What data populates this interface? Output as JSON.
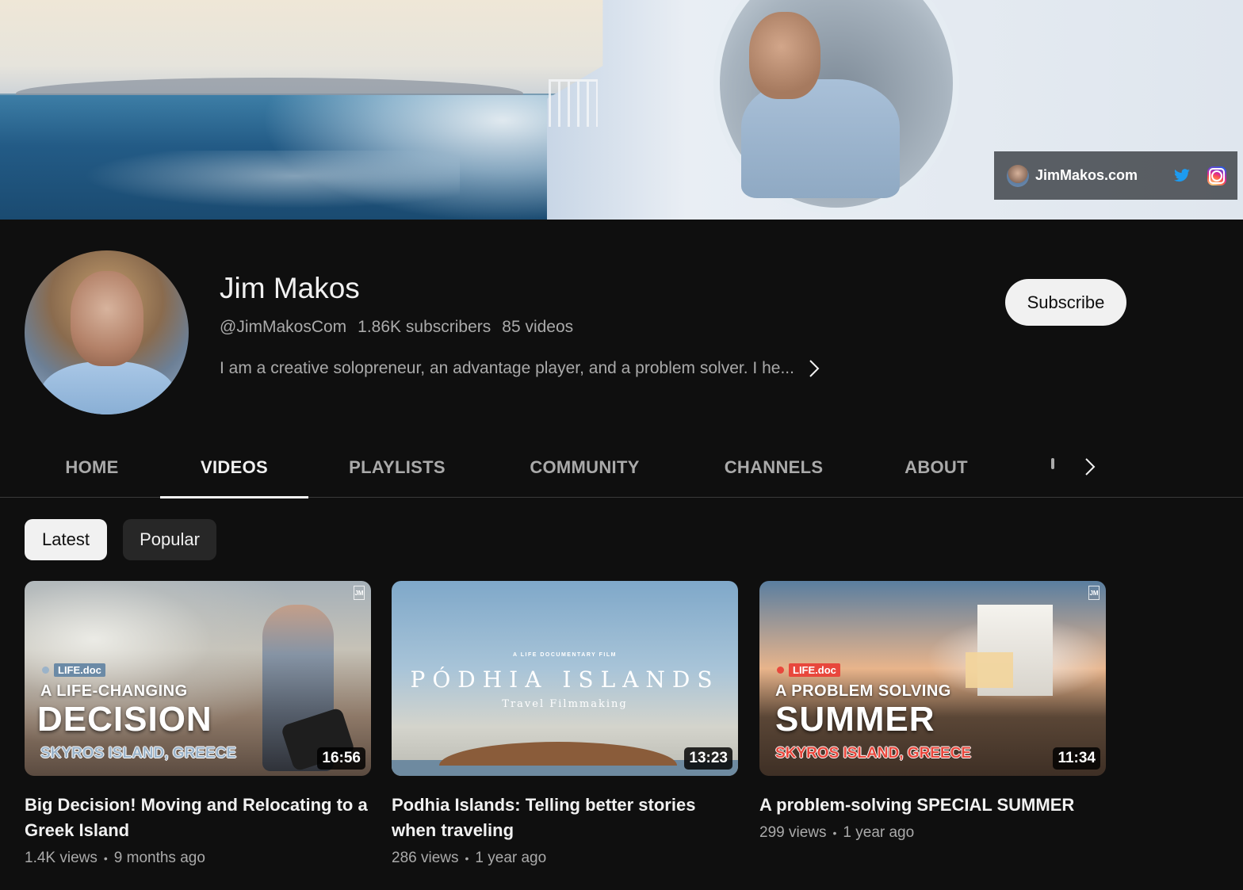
{
  "banner": {
    "link_text": "JimMakos.com",
    "icons": [
      "twitter-icon",
      "instagram-icon"
    ]
  },
  "channel": {
    "name": "Jim Makos",
    "handle": "@JimMakosCom",
    "subscribers": "1.86K subscribers",
    "videos": "85 videos",
    "description": "I am a creative solopreneur, an advantage player, and a problem solver. I he...",
    "subscribe_label": "Subscribe"
  },
  "tabs": [
    {
      "label": "HOME",
      "active": false
    },
    {
      "label": "VIDEOS",
      "active": true
    },
    {
      "label": "PLAYLISTS",
      "active": false
    },
    {
      "label": "COMMUNITY",
      "active": false
    },
    {
      "label": "CHANNELS",
      "active": false
    },
    {
      "label": "ABOUT",
      "active": false
    }
  ],
  "chips": [
    {
      "label": "Latest",
      "selected": true
    },
    {
      "label": "Popular",
      "selected": false
    }
  ],
  "videos": [
    {
      "title": "Big Decision! Moving and Relocating to a Greek Island",
      "views": "1.4K views",
      "age": "9 months ago",
      "duration": "16:56",
      "thumb_tag": "LIFE.doc",
      "thumb_line1": "A LIFE-CHANGING",
      "thumb_line2": "DECISION",
      "thumb_line3": "SKYROS ISLAND, GREECE"
    },
    {
      "title": "Podhia Islands: Telling better stories when traveling",
      "views": "286 views",
      "age": "1 year ago",
      "duration": "13:23",
      "thumb_kicker": "A LIFE DOCUMENTARY FILM",
      "thumb_title": "PÓDHIA ISLANDS",
      "thumb_sub": "Travel Filmmaking"
    },
    {
      "title": "A problem-solving SPECIAL SUMMER",
      "views": "299 views",
      "age": "1 year ago",
      "duration": "11:34",
      "thumb_tag": "LIFE.doc",
      "thumb_line1": "A PROBLEM SOLVING",
      "thumb_line2": "SUMMER",
      "thumb_line3": "SKYROS ISLAND, GREECE"
    }
  ],
  "colors": {
    "background": "#0f0f0f",
    "text_primary": "#f1f1f1",
    "text_secondary": "#aaaaaa",
    "chip_unselected": "#272727",
    "accent_red": "#e8473c"
  }
}
